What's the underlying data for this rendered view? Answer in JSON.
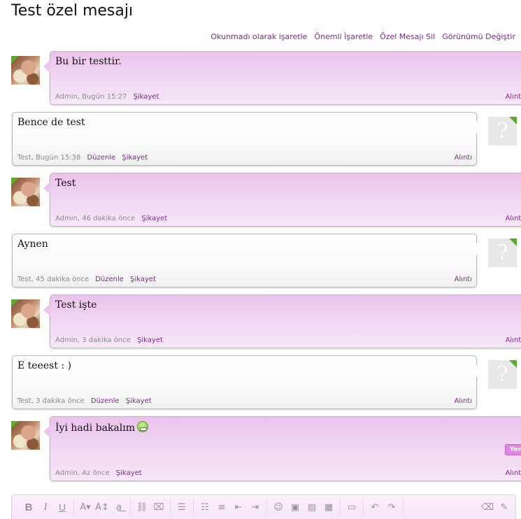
{
  "page": {
    "title": "Test özel mesajı"
  },
  "actions": [
    "Okunmadı olarak işaretle",
    "Önemli İşaretle",
    "Özel Mesajı Sil",
    "Görünümü Değiştir"
  ],
  "messages": [
    {
      "author": "Admin",
      "time": "Bugün 15:27",
      "text": "Bu bir testtir.",
      "links": [
        "Şikayet"
      ],
      "quote": "Alıntı"
    },
    {
      "author": "Test",
      "time": "Bugün 15:38",
      "text": "Bence de test",
      "links": [
        "Düzenle",
        "Şikayet"
      ],
      "quote": "Alıntı"
    },
    {
      "author": "Admin",
      "time": "46 dakika önce",
      "text": "Test",
      "links": [
        "Şikayet"
      ],
      "quote": "Alıntı"
    },
    {
      "author": "Test",
      "time": "45 dakika önce",
      "text": "Aynen",
      "links": [
        "Düzenle",
        "Şikayet"
      ],
      "quote": "Alıntı"
    },
    {
      "author": "Admin",
      "time": "3 dakika önce",
      "text": "Test işte",
      "links": [
        "Şikayet"
      ],
      "quote": "Alıntı"
    },
    {
      "author": "Test",
      "time": "3 dakika önce",
      "text": "E teeest : )",
      "links": [
        "Düzenle",
        "Şikayet"
      ],
      "quote": "Alıntı"
    },
    {
      "author": "Admin",
      "time": "Az önce",
      "text": "İyi hadi bakalım",
      "links": [
        "Şikayet"
      ],
      "quote": "Alıntı",
      "badge": "Yeni"
    }
  ],
  "colors": {
    "link": "#7a2a87",
    "admin_bubble": "#ebc3ec",
    "online_indicator": "#5ea82e",
    "new_badge": "#e286e0"
  },
  "icons": {
    "last_message_emoticon": "grin-emoticon-icon",
    "editor_toolbar": [
      "bold-icon",
      "italic-icon",
      "underline-icon",
      "text-color-icon",
      "font-size-icon",
      "remove-format-icon",
      "link-icon",
      "unlink-icon",
      "align-left-icon",
      "bullet-list-icon",
      "numbered-list-icon",
      "outdent-icon",
      "indent-icon",
      "smilies-icon",
      "insert-image-icon",
      "insert-media-icon",
      "code-block-icon",
      "save-draft-icon",
      "undo-icon",
      "redo-icon",
      "eraser-icon",
      "toggle-bbcode-icon"
    ]
  }
}
